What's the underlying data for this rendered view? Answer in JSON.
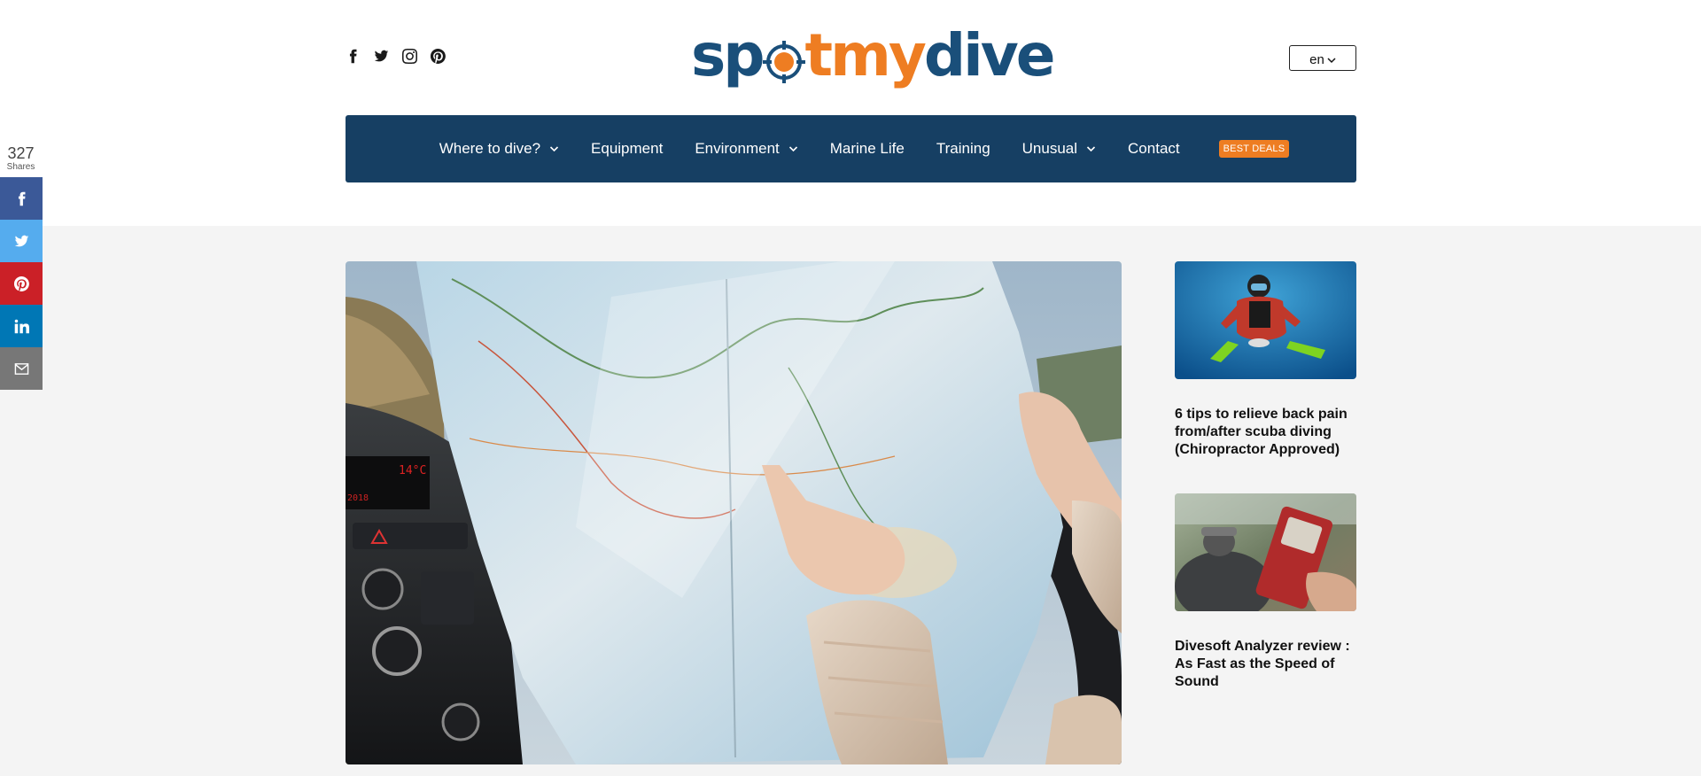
{
  "brand": {
    "logo_parts": [
      "sp",
      "tmy",
      "dive"
    ],
    "color_blue": "#1a4f7a",
    "color_orange": "#ee7d22"
  },
  "header": {
    "social_icons": [
      "facebook-icon",
      "twitter-icon",
      "instagram-icon",
      "pinterest-icon"
    ],
    "language": "en"
  },
  "nav": {
    "items": [
      {
        "label": "Where to dive?",
        "has_dropdown": true
      },
      {
        "label": "Equipment",
        "has_dropdown": false
      },
      {
        "label": "Environment",
        "has_dropdown": true
      },
      {
        "label": "Marine Life",
        "has_dropdown": false
      },
      {
        "label": "Training",
        "has_dropdown": false
      },
      {
        "label": "Unusual",
        "has_dropdown": true
      },
      {
        "label": "Contact",
        "has_dropdown": false
      }
    ],
    "badge": "BEST DEALS",
    "background": "#163f63"
  },
  "share": {
    "count": "327",
    "label": "Shares",
    "buttons": [
      {
        "name": "facebook",
        "color": "#3b5998"
      },
      {
        "name": "twitter",
        "color": "#55acee"
      },
      {
        "name": "pinterest",
        "color": "#cb2027"
      },
      {
        "name": "linkedin",
        "color": "#0077b5"
      },
      {
        "name": "email",
        "color": "#777777"
      }
    ]
  },
  "sidebar": {
    "posts": [
      {
        "title": "6 tips to relieve back pain from/after scuba diving (Chiropractor Approved)",
        "image": "scuba diver underwater"
      },
      {
        "title": "Divesoft Analyzer review : As Fast as the Speed of Sound",
        "image": "gas analyzer device on dive tank"
      }
    ]
  }
}
